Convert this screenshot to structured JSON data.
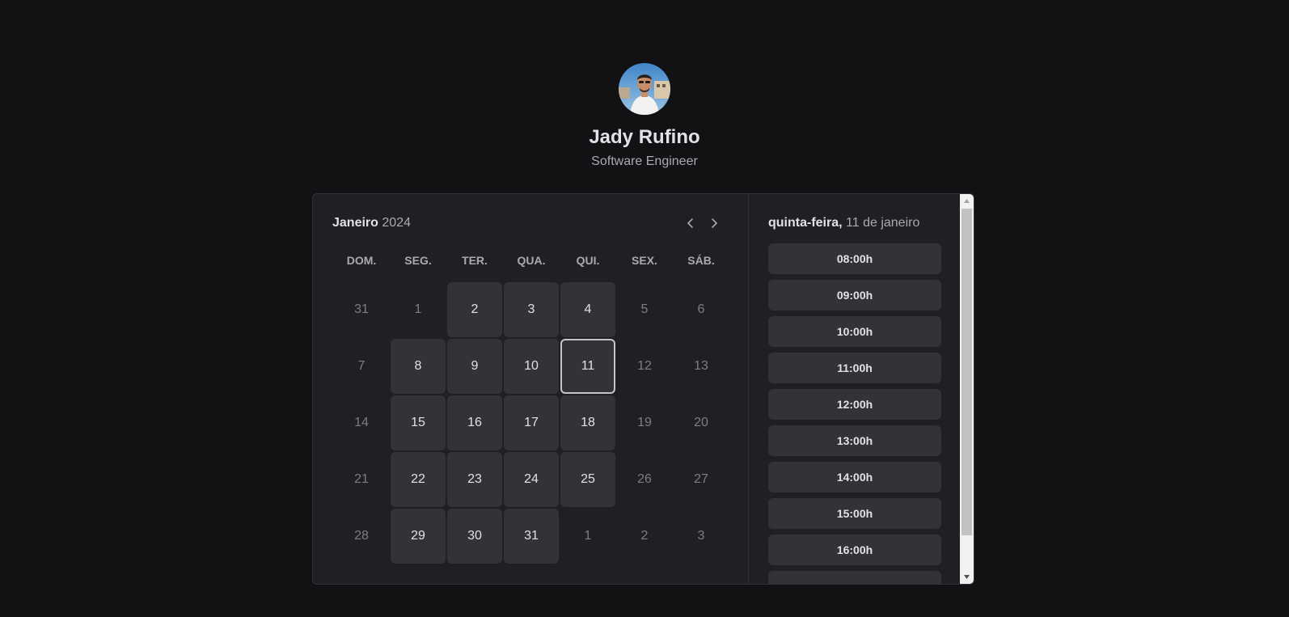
{
  "profile": {
    "name": "Jady Rufino",
    "role": "Software Engineer",
    "avatar_icon": "user-photo"
  },
  "calendar": {
    "month": "Janeiro",
    "year": "2024",
    "prev_icon": "chevron-left-icon",
    "next_icon": "chevron-right-icon",
    "weekdays": [
      "DOM.",
      "SEG.",
      "TER.",
      "QUA.",
      "QUI.",
      "SEX.",
      "SÁB."
    ],
    "weeks": [
      [
        {
          "d": "31",
          "s": "disabled"
        },
        {
          "d": "1",
          "s": "disabled"
        },
        {
          "d": "2",
          "s": "available"
        },
        {
          "d": "3",
          "s": "available"
        },
        {
          "d": "4",
          "s": "available"
        },
        {
          "d": "5",
          "s": "disabled"
        },
        {
          "d": "6",
          "s": "disabled"
        }
      ],
      [
        {
          "d": "7",
          "s": "disabled"
        },
        {
          "d": "8",
          "s": "available"
        },
        {
          "d": "9",
          "s": "available"
        },
        {
          "d": "10",
          "s": "available"
        },
        {
          "d": "11",
          "s": "selected"
        },
        {
          "d": "12",
          "s": "disabled"
        },
        {
          "d": "13",
          "s": "disabled"
        }
      ],
      [
        {
          "d": "14",
          "s": "disabled"
        },
        {
          "d": "15",
          "s": "available"
        },
        {
          "d": "16",
          "s": "available"
        },
        {
          "d": "17",
          "s": "available"
        },
        {
          "d": "18",
          "s": "available"
        },
        {
          "d": "19",
          "s": "disabled"
        },
        {
          "d": "20",
          "s": "disabled"
        }
      ],
      [
        {
          "d": "21",
          "s": "disabled"
        },
        {
          "d": "22",
          "s": "available"
        },
        {
          "d": "23",
          "s": "available"
        },
        {
          "d": "24",
          "s": "available"
        },
        {
          "d": "25",
          "s": "available"
        },
        {
          "d": "26",
          "s": "disabled"
        },
        {
          "d": "27",
          "s": "disabled"
        }
      ],
      [
        {
          "d": "28",
          "s": "disabled"
        },
        {
          "d": "29",
          "s": "available"
        },
        {
          "d": "30",
          "s": "available"
        },
        {
          "d": "31",
          "s": "available"
        },
        {
          "d": "1",
          "s": "disabled"
        },
        {
          "d": "2",
          "s": "disabled"
        },
        {
          "d": "3",
          "s": "disabled"
        }
      ]
    ]
  },
  "times": {
    "weekday": "quinta-feira,",
    "date": "11 de janeiro",
    "slots": [
      "08:00h",
      "09:00h",
      "10:00h",
      "11:00h",
      "12:00h",
      "13:00h",
      "14:00h",
      "15:00h",
      "16:00h",
      ""
    ]
  },
  "colors": {
    "background": "#121214",
    "card": "#202024",
    "day_available": "#323238",
    "selected_border": "#c4c4cc",
    "text": "#e1e1e6",
    "muted": "#7c7c8a"
  }
}
